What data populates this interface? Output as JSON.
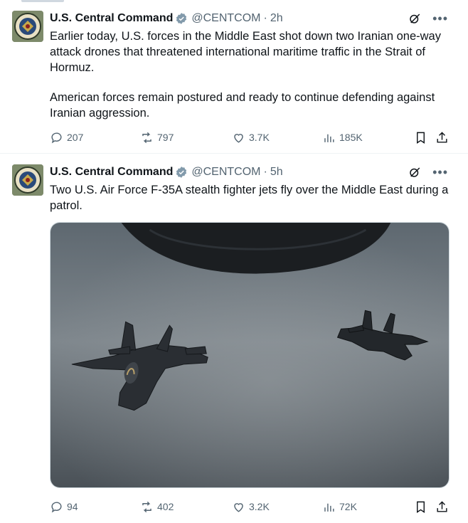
{
  "tweets": [
    {
      "author": "U.S. Central Command",
      "handle": "@CENTCOM",
      "separator": "·",
      "time": "2h",
      "paragraphs": [
        "Earlier today, U.S. forces in the Middle East shot down two Iranian one-way attack drones that threatened international maritime traffic in the Strait of Hormuz.",
        "American forces remain postured and ready to continue defending against Iranian aggression."
      ],
      "replies": "207",
      "reposts": "797",
      "likes": "3.7K",
      "views": "185K"
    },
    {
      "author": "U.S. Central Command",
      "handle": "@CENTCOM",
      "separator": "·",
      "time": "5h",
      "paragraphs": [
        "Two U.S. Air Force F-35A stealth fighter jets fly over the Middle East during a patrol."
      ],
      "replies": "94",
      "reposts": "402",
      "likes": "3.2K",
      "views": "72K"
    }
  ],
  "icons": {
    "reply": "reply-icon",
    "repost": "repost-icon",
    "like": "heart-icon",
    "views": "views-icon",
    "bookmark": "bookmark-icon",
    "share": "share-icon",
    "verified": "verified-badge-icon",
    "grok": "grok-icon",
    "more": "more-icon"
  },
  "colors": {
    "text_primary": "#0f1419",
    "text_secondary": "#536471",
    "verified_badge": "#829aab",
    "divider": "#eff3f4"
  },
  "media": {
    "description_alt": ""
  }
}
